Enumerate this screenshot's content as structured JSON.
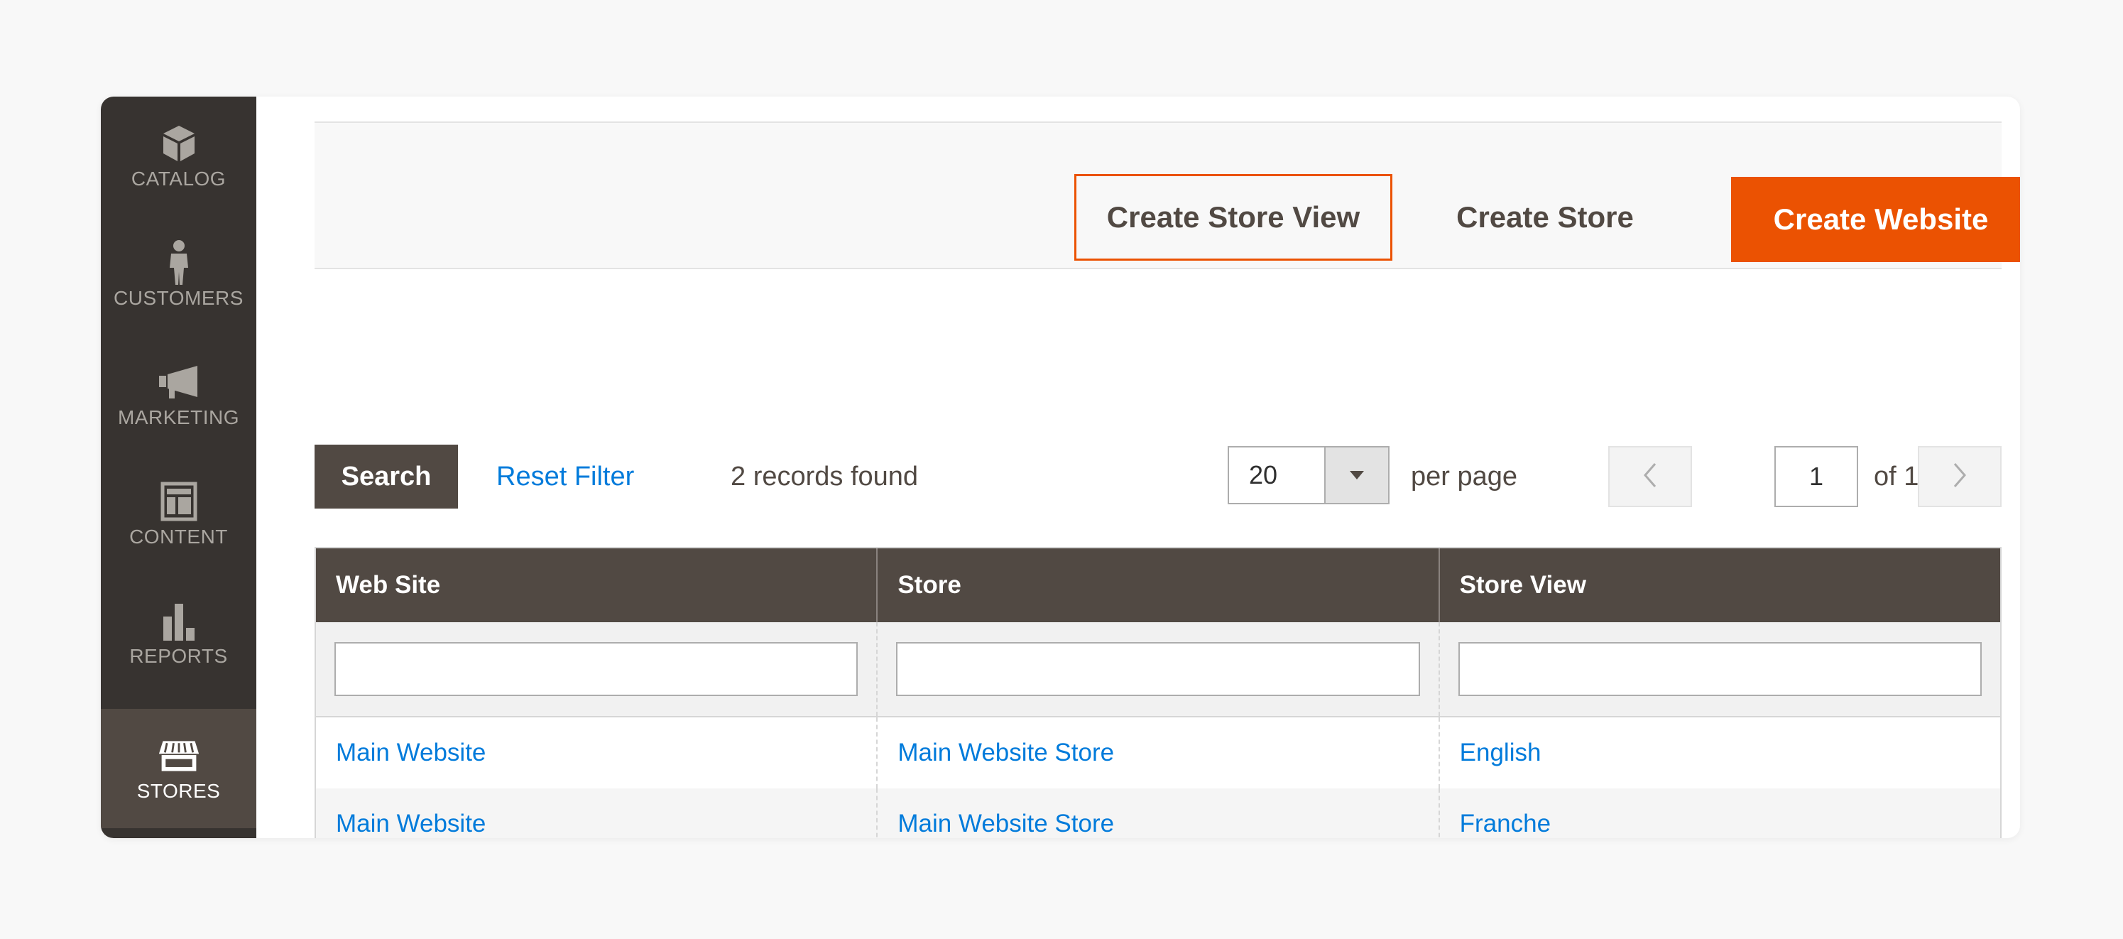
{
  "sidebar": {
    "items": [
      {
        "label": "CATALOG",
        "icon": "box-icon"
      },
      {
        "label": "CUSTOMERS",
        "icon": "person-icon"
      },
      {
        "label": "MARKETING",
        "icon": "megaphone-icon"
      },
      {
        "label": "CONTENT",
        "icon": "layout-icon"
      },
      {
        "label": "REPORTS",
        "icon": "bar-chart-icon"
      },
      {
        "label": "STORES",
        "icon": "storefront-icon",
        "active": true
      }
    ]
  },
  "actions": {
    "create_store_view": "Create Store View",
    "create_store": "Create Store",
    "create_website": "Create Website"
  },
  "toolbar": {
    "search_label": "Search",
    "reset_label": "Reset Filter",
    "records_text": "2 records found",
    "per_page_value": "20",
    "per_page_label": "per page",
    "current_page": "1",
    "page_total_text": "of 1"
  },
  "grid": {
    "columns": [
      "Web Site",
      "Store",
      "Store View"
    ],
    "rows": [
      [
        "Main Website",
        "Main Website Store",
        "English"
      ],
      [
        "Main Website",
        "Main Website Store",
        "Franche"
      ]
    ]
  },
  "colors": {
    "accent": "#eb5202",
    "header": "#514943",
    "sidebar": "#373330",
    "link": "#007bdb"
  }
}
